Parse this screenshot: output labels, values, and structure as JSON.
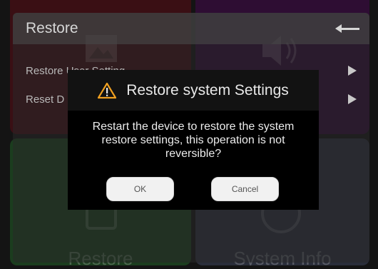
{
  "background": {
    "tiles": [
      {
        "label": ""
      },
      {
        "label": ""
      },
      {
        "label": "Restore"
      },
      {
        "label": "System Info"
      }
    ]
  },
  "panel": {
    "title": "Restore",
    "items": [
      {
        "label": "Restore User Setting"
      },
      {
        "label": "Reset D"
      }
    ]
  },
  "dialog": {
    "title": "Restore system Settings",
    "message": "Restart the device to restore the system restore settings, this operation is not reversible?",
    "ok_label": "OK",
    "cancel_label": "Cancel"
  },
  "colors": {
    "warning_icon": "#f0a020",
    "dialog_bg": "#000000",
    "button_bg": "#f1f1f1"
  },
  "icons": [
    "back-arrow-icon",
    "play-arrow-icon",
    "warning-icon"
  ]
}
